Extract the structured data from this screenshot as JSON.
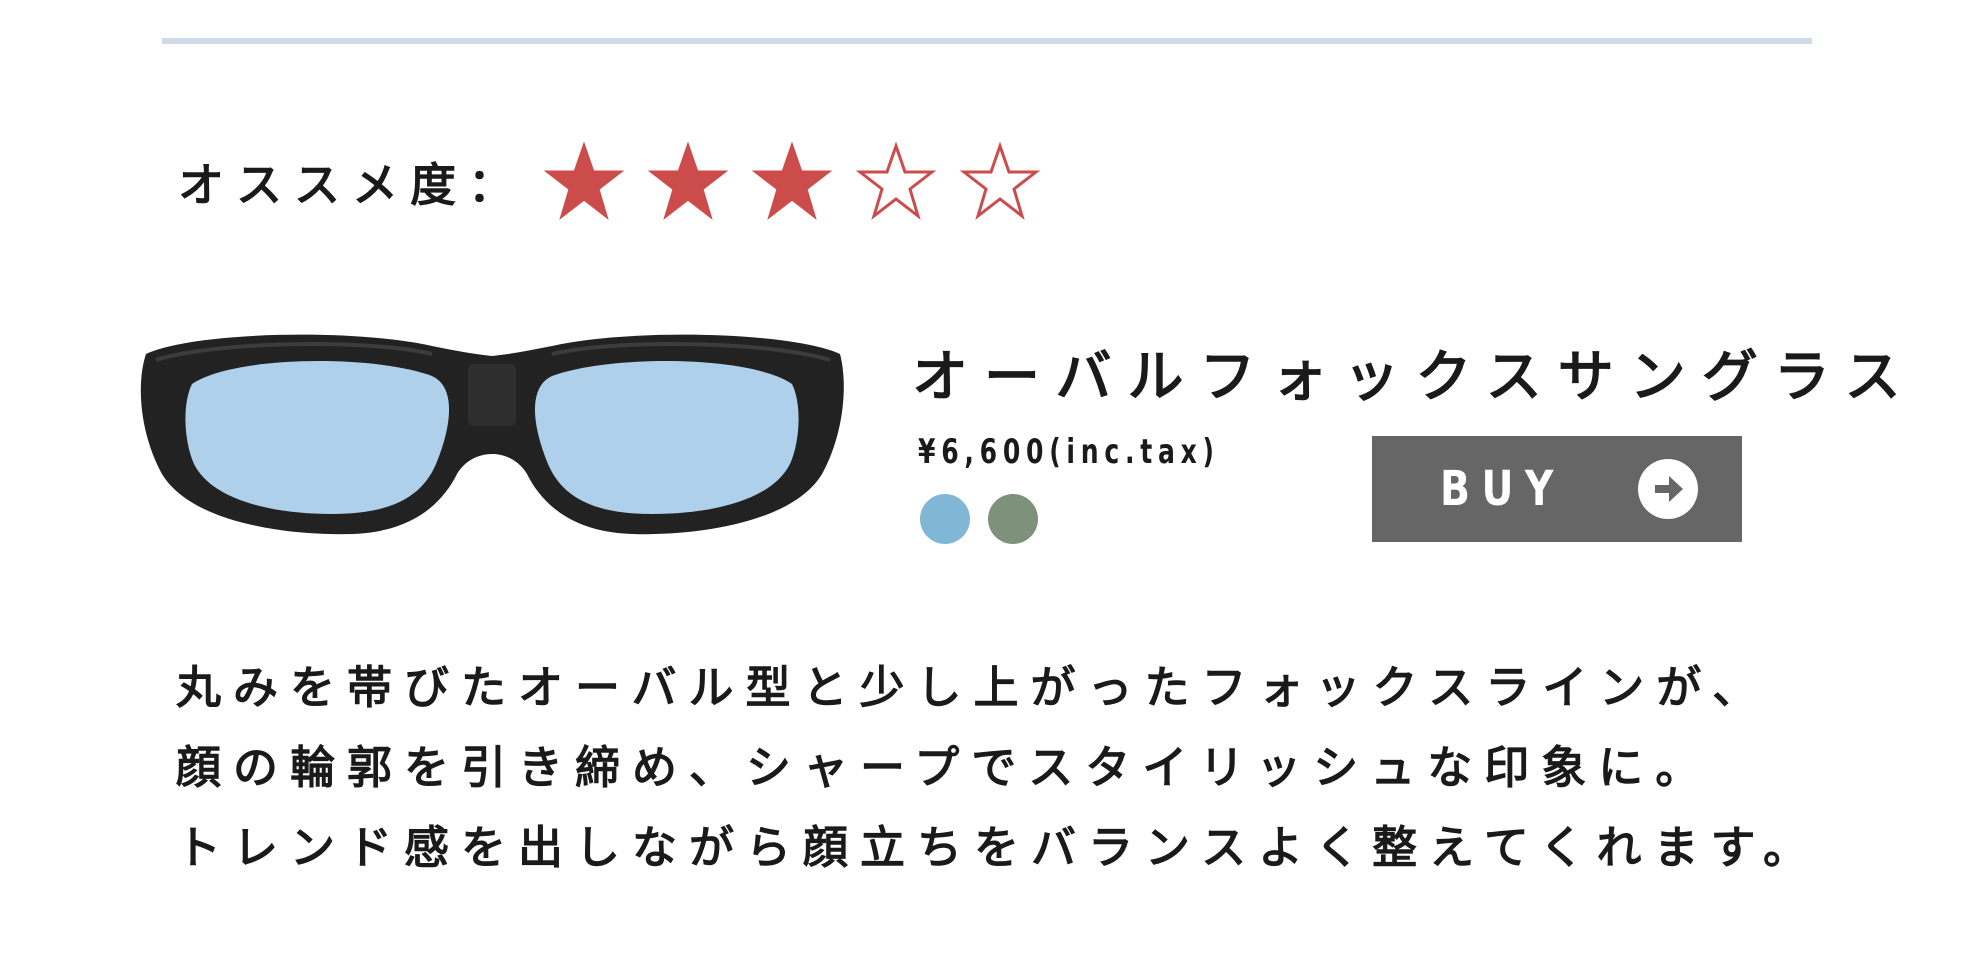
{
  "rating": {
    "label": "オススメ度：",
    "score": 3,
    "max": 5,
    "filled_color": "#cc4b4b",
    "empty_color": "#cc4b4b"
  },
  "product": {
    "image_icon": "oval-sunglasses-image",
    "frame_color": "#222222",
    "lens_color": "#aed0ea",
    "name": "オーバルフォックスサングラス",
    "price": "¥6,600(inc.tax)",
    "color_options": [
      {
        "name": "light-blue",
        "hex": "#80b6d6"
      },
      {
        "name": "green",
        "hex": "#7e917a"
      }
    ],
    "buy_label": "BUY",
    "buy_icon": "arrow-right-circle-icon",
    "buy_bg": "#666666"
  },
  "description": {
    "lines": [
      "丸みを帯びたオーバル型と少し上がったフォックスラインが、",
      "顔の輪郭を引き締め、シャープでスタイリッシュな印象に。",
      "トレンド感を出しながら顔立ちをバランスよく整えてくれます。"
    ]
  }
}
